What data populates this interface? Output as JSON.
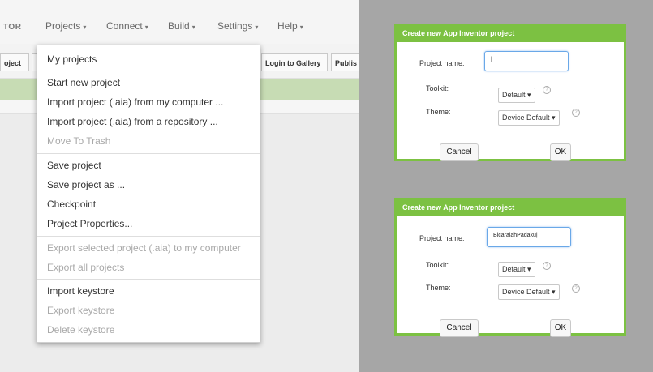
{
  "app": {
    "logo_text": "TOR",
    "menus": [
      {
        "label": "Projects"
      },
      {
        "label": "Connect"
      },
      {
        "label": "Build"
      },
      {
        "label": "Settings"
      },
      {
        "label": "Help"
      }
    ],
    "toolbar": {
      "left_button": "oject",
      "login_gallery": "Login to Gallery",
      "publish": "Publis"
    }
  },
  "projects_menu": {
    "items": [
      {
        "label": "My projects",
        "disabled": false
      },
      {
        "label": "Start new project",
        "disabled": false
      },
      {
        "label": "Import project (.aia) from my computer ...",
        "disabled": false
      },
      {
        "label": "Import project (.aia) from a repository ...",
        "disabled": false
      },
      {
        "label": "Move To Trash",
        "disabled": true
      },
      {
        "label": "Save project",
        "disabled": false
      },
      {
        "label": "Save project as ...",
        "disabled": false
      },
      {
        "label": "Checkpoint",
        "disabled": false
      },
      {
        "label": "Project Properties...",
        "disabled": false
      },
      {
        "label": "Export selected project (.aia) to my computer",
        "disabled": true
      },
      {
        "label": "Export all projects",
        "disabled": true
      },
      {
        "label": "Import keystore",
        "disabled": false
      },
      {
        "label": "Export keystore",
        "disabled": true
      },
      {
        "label": "Delete keystore",
        "disabled": true
      }
    ]
  },
  "dialogs": [
    {
      "title": "Create new App Inventor project",
      "project_name_label": "Project name:",
      "project_name_value": "|",
      "toolkit_label": "Toolkit:",
      "toolkit_value": "Default",
      "theme_label": "Theme:",
      "theme_value": "Device Default",
      "cancel_label": "Cancel",
      "ok_label": "OK",
      "help_glyph": "?"
    },
    {
      "title": "Create new App Inventor project",
      "project_name_label": "Project name:",
      "project_name_value": "BicaralahPadaku|",
      "toolkit_label": "Toolkit:",
      "toolkit_value": "Default",
      "theme_label": "Theme:",
      "theme_value": "Device Default",
      "cancel_label": "Cancel",
      "ok_label": "OK",
      "help_glyph": "?"
    }
  ],
  "colors": {
    "dialog_accent": "#7cc142",
    "gallery_bar": "#c7dcb4",
    "right_background": "#a6a6a6",
    "input_focus": "#6aa8e8"
  },
  "icons": {
    "caret": "caret-down-icon",
    "help": "help-circle-icon"
  }
}
